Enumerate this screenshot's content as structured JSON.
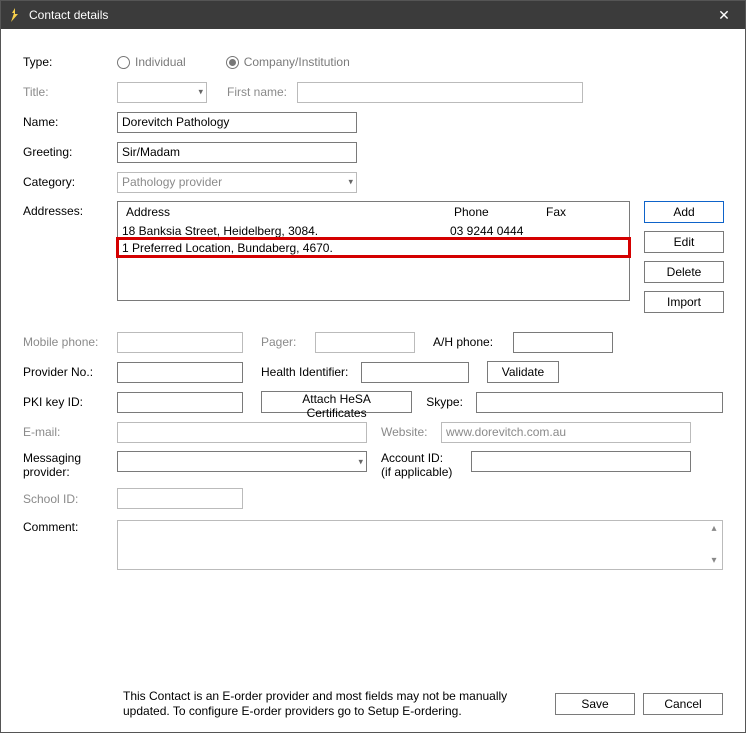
{
  "window": {
    "title": "Contact details"
  },
  "labels": {
    "type": "Type:",
    "title": "Title:",
    "firstname": "First name:",
    "name": "Name:",
    "greeting": "Greeting:",
    "category": "Category:",
    "addresses": "Addresses:",
    "mobile": "Mobile phone:",
    "pager": "Pager:",
    "ahphone": "A/H phone:",
    "provider": "Provider No.:",
    "healthid": "Health Identifier:",
    "validate": "Validate",
    "pki": "PKI key ID:",
    "attach": "Attach HeSA Certificates",
    "skype": "Skype:",
    "email": "E-mail:",
    "website": "Website:",
    "messaging1": "Messaging",
    "messaging2": "provider:",
    "account1": "Account ID:",
    "account2": "(if applicable)",
    "school": "School ID:",
    "comment": "Comment:"
  },
  "type_radio": {
    "individual": "Individual",
    "company": "Company/Institution",
    "selected": "company"
  },
  "fields": {
    "title": "",
    "firstname": "",
    "name": "Dorevitch Pathology",
    "greeting": "Sir/Madam",
    "category": "Pathology provider",
    "mobile": "",
    "pager": "",
    "ahphone": "",
    "provider": "",
    "healthid": "",
    "pki": "",
    "skype": "",
    "email": "",
    "website": "www.dorevitch.com.au",
    "messaging": "",
    "account": "",
    "school": "",
    "comment": ""
  },
  "address_table": {
    "headers": {
      "address": "Address",
      "phone": "Phone",
      "fax": "Fax"
    },
    "rows": [
      {
        "address": "18 Banksia Street, Heidelberg, 3084.",
        "phone": "03 9244 0444",
        "fax": "",
        "highlight": false
      },
      {
        "address": "1 Preferred Location, Bundaberg, 4670.",
        "phone": "",
        "fax": "",
        "highlight": true
      }
    ]
  },
  "buttons": {
    "add": "Add",
    "edit": "Edit",
    "delete": "Delete",
    "import": "Import",
    "save": "Save",
    "cancel": "Cancel"
  },
  "footer_note": "This Contact is an E-order provider and most fields may not be manually updated. To configure E-order providers go to Setup E-ordering."
}
